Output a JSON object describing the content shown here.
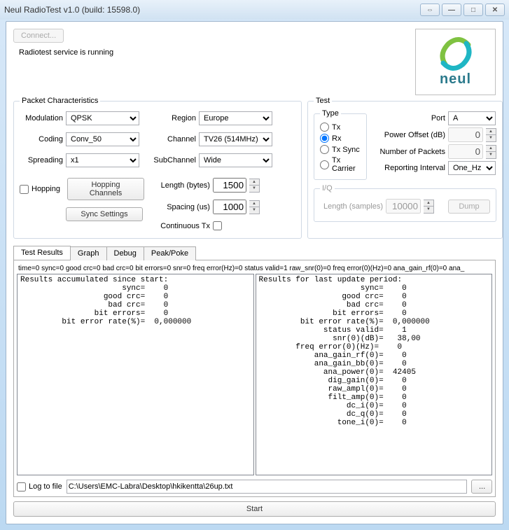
{
  "window": {
    "title": "Neul RadioTest v1.0 (build: 15598.0)"
  },
  "header": {
    "connect_label": "Connect...",
    "status": "Radiotest service is running",
    "logo_text": "neul"
  },
  "packet": {
    "legend": "Packet Characteristics",
    "modulation_label": "Modulation",
    "modulation_value": "QPSK",
    "coding_label": "Coding",
    "coding_value": "Conv_50",
    "spreading_label": "Spreading",
    "spreading_value": "x1",
    "region_label": "Region",
    "region_value": "Europe",
    "channel_label": "Channel",
    "channel_value": "TV26 (514MHz)",
    "subchannel_label": "SubChannel",
    "subchannel_value": "Wide",
    "length_label": "Length (bytes)",
    "length_value": "1500",
    "spacing_label": "Spacing (us)",
    "spacing_value": "1000",
    "continuous_label": "Continuous Tx",
    "hopping_label": "Hopping",
    "hopping_channels_label": "Hopping Channels",
    "sync_settings_label": "Sync Settings"
  },
  "test": {
    "legend": "Test",
    "type_legend": "Type",
    "type_tx": "Tx",
    "type_rx": "Rx",
    "type_txsync": "Tx Sync",
    "type_txcarrier": "Tx Carrier",
    "port_label": "Port",
    "port_value": "A",
    "power_offset_label": "Power Offset (dB)",
    "power_offset_value": "0",
    "num_packets_label": "Number of Packets",
    "num_packets_value": "0",
    "reporting_label": "Reporting Interval",
    "reporting_value": "One_Hz",
    "iq_legend": "I/Q",
    "iq_length_label": "Length (samples)",
    "iq_length_value": "10000",
    "iq_dump_label": "Dump"
  },
  "tabs": {
    "results": "Test Results",
    "graph": "Graph",
    "debug": "Debug",
    "peak": "Peak/Poke"
  },
  "results": {
    "oneline": "time=0 sync=0 good crc=0 bad crc=0 bit errors=0 snr=0 freq error(Hz)=0 status valid=1 raw_snr(0)=0 freq error(0)(Hz)=0 ana_gain_rf(0)=0 ana_",
    "left": "Results accumulated since start:\n                      sync=    0\n                  good crc=    0\n                   bad crc=    0\n                bit errors=    0\n         bit error rate(%)=  0,000000",
    "right": "Results for last update period:\n                      sync=    0\n                  good crc=    0\n                   bad crc=    0\n                bit errors=    0\n         bit error rate(%)=  0,000000\n              status valid=    1\n                snr(0)(dB)=   38,00\n        freq error(0)(Hz)=    0\n            ana_gain_rf(0)=    0\n            ana_gain_bb(0)=    0\n              ana_power(0)=  42405\n               dig_gain(0)=    0\n               raw_ampl(0)=    0\n               filt_amp(0)=    0\n                   dc_i(0)=    0\n                   dc_q(0)=    0\n                 tone_i(0)=    0\n"
  },
  "bottom": {
    "log_label": "Log to file",
    "path": "C:\\Users\\EMC-Labra\\Desktop\\hkikentta\\26up.txt",
    "browse": "...",
    "start": "Start"
  }
}
